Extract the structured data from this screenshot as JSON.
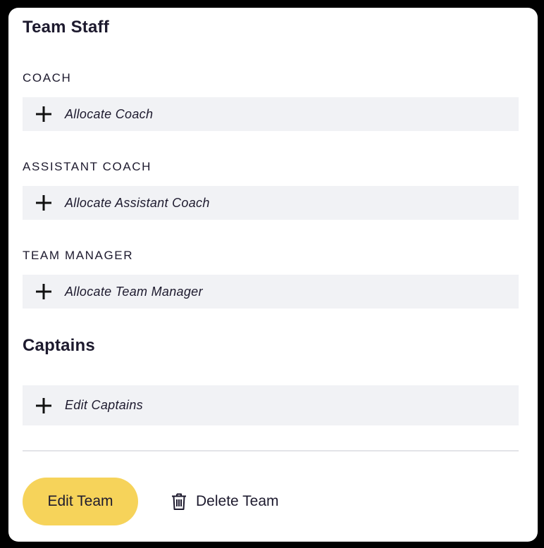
{
  "team_staff": {
    "title": "Team Staff",
    "roles": [
      {
        "label": "COACH",
        "action": "Allocate Coach",
        "icon": "plus-icon"
      },
      {
        "label": "ASSISTANT COACH",
        "action": "Allocate Assistant Coach",
        "icon": "plus-icon"
      },
      {
        "label": "TEAM MANAGER",
        "action": "Allocate Team Manager",
        "icon": "plus-icon"
      }
    ]
  },
  "captains": {
    "title": "Captains",
    "action": "Edit Captains",
    "icon": "plus-icon"
  },
  "footer": {
    "edit_label": "Edit Team",
    "delete_label": "Delete Team",
    "delete_icon": "trash-icon"
  },
  "colors": {
    "accent": "#f6d35a",
    "row_background": "#f1f2f5",
    "text": "#1d1a2e",
    "divider": "#e3e4e8"
  }
}
